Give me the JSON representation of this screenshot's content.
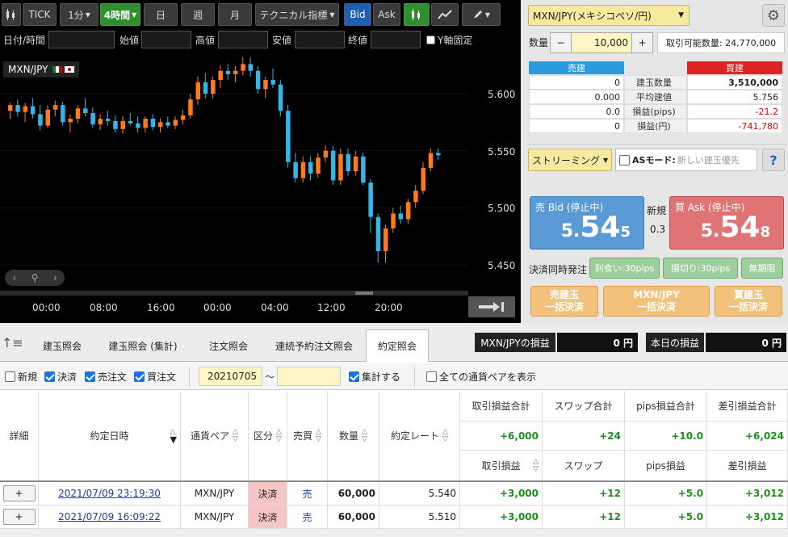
{
  "toolbar": {
    "tick_label": "TICK",
    "interval_1m": "1分",
    "interval_4h": "4時間",
    "interval_day": "日",
    "interval_week": "週",
    "interval_month": "月",
    "technical_label": "テクニカル指標",
    "bid_label": "Bid",
    "ask_label": "Ask"
  },
  "filters": {
    "datetime_label": "日付/時間",
    "open_label": "始値",
    "high_label": "高値",
    "low_label": "安値",
    "close_label": "終値",
    "yaxis_fix_label": "Y軸固定"
  },
  "chart": {
    "symbol": "MXN/JPY",
    "price_labels": [
      "5.600",
      "5.550",
      "5.500",
      "5.450"
    ],
    "time_labels": [
      "00:00",
      "08:00",
      "16:00",
      "00:00",
      "04:00",
      "12:00",
      "20:00"
    ]
  },
  "chart_data": {
    "type": "candlestick",
    "ylim": [
      5.43,
      5.655
    ],
    "candles": [
      [
        5.585,
        5.592,
        5.578,
        5.59
      ],
      [
        5.59,
        5.595,
        5.58,
        5.584
      ],
      [
        5.584,
        5.592,
        5.575,
        5.589
      ],
      [
        5.589,
        5.596,
        5.578,
        5.582
      ],
      [
        5.582,
        5.59,
        5.568,
        5.572
      ],
      [
        5.572,
        5.59,
        5.57,
        5.586
      ],
      [
        5.586,
        5.594,
        5.58,
        5.59
      ],
      [
        5.59,
        5.593,
        5.572,
        5.575
      ],
      [
        5.575,
        5.582,
        5.566,
        5.578
      ],
      [
        5.578,
        5.59,
        5.574,
        5.587
      ],
      [
        5.587,
        5.596,
        5.58,
        5.583
      ],
      [
        5.583,
        5.588,
        5.57,
        5.573
      ],
      [
        5.573,
        5.582,
        5.568,
        5.578
      ],
      [
        5.578,
        5.585,
        5.572,
        5.576
      ],
      [
        5.576,
        5.581,
        5.566,
        5.569
      ],
      [
        5.569,
        5.58,
        5.565,
        5.576
      ],
      [
        5.576,
        5.583,
        5.572,
        5.574
      ],
      [
        5.574,
        5.58,
        5.566,
        5.57
      ],
      [
        5.57,
        5.58,
        5.566,
        5.578
      ],
      [
        5.578,
        5.582,
        5.568,
        5.571
      ],
      [
        5.571,
        5.578,
        5.566,
        5.575
      ],
      [
        5.575,
        5.58,
        5.57,
        5.572
      ],
      [
        5.572,
        5.58,
        5.569,
        5.577
      ],
      [
        5.577,
        5.586,
        5.573,
        5.581
      ],
      [
        5.581,
        5.6,
        5.578,
        5.595
      ],
      [
        5.595,
        5.615,
        5.59,
        5.61
      ],
      [
        5.61,
        5.618,
        5.596,
        5.6
      ],
      [
        5.6,
        5.615,
        5.596,
        5.612
      ],
      [
        5.612,
        5.625,
        5.605,
        5.62
      ],
      [
        5.62,
        5.626,
        5.612,
        5.617
      ],
      [
        5.617,
        5.624,
        5.61,
        5.62
      ],
      [
        5.62,
        5.632,
        5.616,
        5.626
      ],
      [
        5.626,
        5.632,
        5.615,
        5.62
      ],
      [
        5.62,
        5.624,
        5.6,
        5.604
      ],
      [
        5.604,
        5.615,
        5.596,
        5.612
      ],
      [
        5.612,
        5.622,
        5.605,
        5.608
      ],
      [
        5.608,
        5.612,
        5.58,
        5.585
      ],
      [
        5.585,
        5.59,
        5.535,
        5.54
      ],
      [
        5.54,
        5.548,
        5.522,
        5.526
      ],
      [
        5.526,
        5.545,
        5.522,
        5.54
      ],
      [
        5.54,
        5.545,
        5.524,
        5.53
      ],
      [
        5.53,
        5.548,
        5.526,
        5.544
      ],
      [
        5.544,
        5.555,
        5.54,
        5.55
      ],
      [
        5.55,
        5.554,
        5.52,
        5.524
      ],
      [
        5.524,
        5.552,
        5.52,
        5.547
      ],
      [
        5.547,
        5.552,
        5.528,
        5.532
      ],
      [
        5.532,
        5.55,
        5.528,
        5.545
      ],
      [
        5.545,
        5.548,
        5.52,
        5.522
      ],
      [
        5.522,
        5.525,
        5.478,
        5.492
      ],
      [
        5.492,
        5.495,
        5.452,
        5.462
      ],
      [
        5.462,
        5.485,
        5.452,
        5.482
      ],
      [
        5.482,
        5.5,
        5.478,
        5.495
      ],
      [
        5.495,
        5.502,
        5.486,
        5.49
      ],
      [
        5.49,
        5.508,
        5.486,
        5.505
      ],
      [
        5.505,
        5.52,
        5.5,
        5.515
      ],
      [
        5.515,
        5.54,
        5.512,
        5.535
      ],
      [
        5.535,
        5.552,
        5.532,
        5.548
      ],
      [
        5.548,
        5.552,
        5.542,
        5.546
      ]
    ]
  },
  "order": {
    "symbol_select": "MXN/JPY(メキシコペソ/円)",
    "qty_label": "数量",
    "qty_minus": "−",
    "qty_value": "10,000",
    "qty_plus": "+",
    "tradable_label": "取引可能数量: 24,770,000"
  },
  "positions": {
    "sell_header": "売建",
    "buy_header": "買建",
    "rows": [
      {
        "sell": "0",
        "label": "建玉数量",
        "buy": "3,510,000"
      },
      {
        "sell": "0.000",
        "label": "平均建値",
        "buy": "5.756"
      },
      {
        "sell": "0.0",
        "label": "損益(pips)",
        "buy": "-21.2"
      },
      {
        "sell": "0",
        "label": "損益(円)",
        "buy": "-741,780"
      }
    ]
  },
  "streaming": {
    "mode_label": "ストリーミング",
    "as_mode_label": "ASモード:",
    "as_mode_value": "新しい建玉優先",
    "help": "?"
  },
  "quotes": {
    "bid_label": "売 Bid (停止中)",
    "bid_small": "5.",
    "bid_big": "54",
    "bid_last": "5",
    "new_label": "新規",
    "spread": "0.3",
    "ask_label": "買 Ask (停止中)",
    "ask_small": "5.",
    "ask_big": "54",
    "ask_last": "8"
  },
  "settle": {
    "label": "決済同時発注",
    "take_profit": "利食い:30pips",
    "stop_loss": "損切り:30pips",
    "unlimited": "無期限"
  },
  "bulk": {
    "sell_line1": "売建玉",
    "sell_line2": "一括決済",
    "pair_line1": "MXN/JPY",
    "pair_line2": "一括決済",
    "buy_line1": "買建玉",
    "buy_line2": "一括決済"
  },
  "tabs": [
    "建玉照会",
    "建玉照会 (集計)",
    "注文照会",
    "連続予約注文照会",
    "約定照会"
  ],
  "pl_boxes": {
    "pair_label": "MXN/JPYの損益",
    "pair_value": "0 円",
    "today_label": "本日の損益",
    "today_value": "0 円"
  },
  "filter_bar": {
    "new": "新規",
    "settle": "決済",
    "sell_order": "売注文",
    "buy_order": "買注文",
    "date_from": "20210705",
    "tilde": "〜",
    "aggregate": "集計する",
    "all_pairs": "全ての通貨ペアを表示"
  },
  "table": {
    "headers": {
      "detail": "詳細",
      "datetime": "約定日時",
      "pair": "通貨ペア",
      "kind": "区分",
      "side": "売買",
      "qty": "数量",
      "rate": "約定レート",
      "trade_pl_total": "取引損益合計",
      "swap_total": "スワップ合計",
      "pips_total": "pips損益合計",
      "net_total": "差引損益合計",
      "trade_pl": "取引損益",
      "swap": "スワップ",
      "pips": "pips損益",
      "net": "差引損益"
    },
    "totals": {
      "trade_pl": "+6,000",
      "swap": "+24",
      "pips": "+10.0",
      "net": "+6,024"
    },
    "rows": [
      {
        "btn": "+",
        "datetime": "2021/07/09 23:19:30",
        "pair": "MXN/JPY",
        "kind": "決済",
        "side": "売",
        "qty": "60,000",
        "rate": "5.540",
        "trade_pl": "+3,000",
        "swap": "+12",
        "pips": "+5.0",
        "net": "+3,012"
      },
      {
        "btn": "+",
        "datetime": "2021/07/09 16:09:22",
        "pair": "MXN/JPY",
        "kind": "決済",
        "side": "売",
        "qty": "60,000",
        "rate": "5.510",
        "trade_pl": "+3,000",
        "swap": "+12",
        "pips": "+5.0",
        "net": "+3,012"
      }
    ]
  },
  "colors": {
    "up": "#ff7a1a",
    "down": "#36b6e6",
    "bid_bg": "#5b9bd5",
    "ask_bg": "#e07474",
    "accent": "#1e8f1e"
  }
}
